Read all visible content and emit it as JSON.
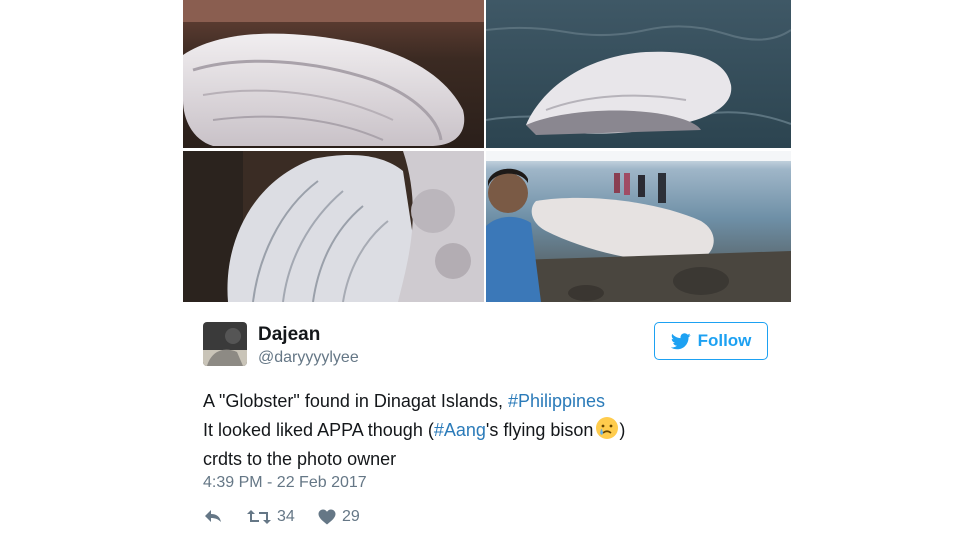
{
  "user": {
    "display_name": "Dajean",
    "handle": "@daryyyylyee"
  },
  "follow": {
    "label": "Follow",
    "icon": "twitter-bird-icon"
  },
  "tweet": {
    "line1_text": "A \"Globster\" found in Dinagat Islands, ",
    "line1_hashtag": "#Philippines",
    "line2_pre": "It looked liked APPA though (",
    "line2_hashtag": "#Aang",
    "line2_mid": "'s flying bison",
    "line2_emoji": "crying-face-icon",
    "line2_post": ")",
    "line3": "crdts to the photo owner",
    "timestamp": "4:39 PM - 22 Feb 2017"
  },
  "actions": {
    "reply_icon": "reply-icon",
    "retweet_icon": "retweet-icon",
    "retweet_count": "34",
    "like_icon": "heart-icon",
    "like_count": "29"
  },
  "colors": {
    "accent": "#1da1f2",
    "hashtag": "#2b7bb9",
    "secondary_text": "#657786",
    "primary_text": "#14171a"
  }
}
